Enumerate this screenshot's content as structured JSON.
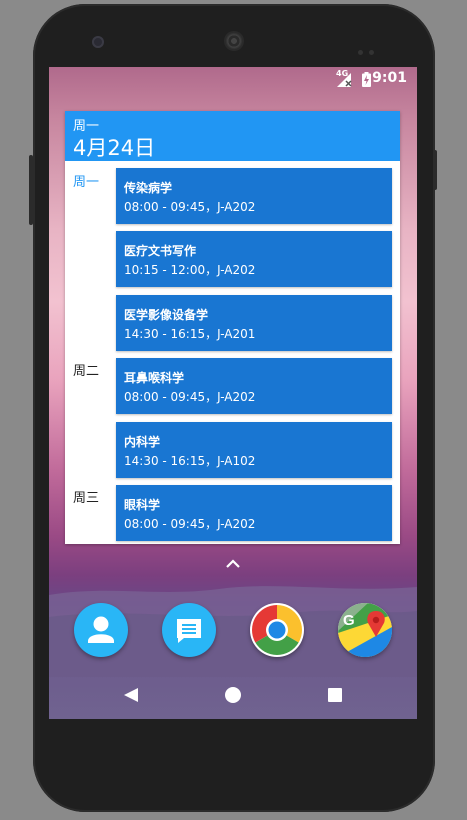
{
  "status_bar": {
    "network_type": "4G",
    "time": "9:01",
    "icons": [
      "signal-icon",
      "battery-charging-icon"
    ]
  },
  "widget": {
    "header": {
      "weekday": "周一",
      "date": "4月24日"
    },
    "days": [
      {
        "label": "周一",
        "is_today": true
      },
      {
        "label": "周二",
        "is_today": false
      },
      {
        "label": "周三",
        "is_today": false
      }
    ],
    "events": [
      {
        "title": "传染病学",
        "detail": "08:00 - 09:45，J-A202"
      },
      {
        "title": "医疗文书写作",
        "detail": "10:15 - 12:00，J-A202"
      },
      {
        "title": "医学影像设备学",
        "detail": "14:30 - 16:15，J-A201"
      },
      {
        "title": "耳鼻喉科学",
        "detail": "08:00 - 09:45，J-A202"
      },
      {
        "title": "内科学",
        "detail": "14:30 - 16:15，J-A102"
      },
      {
        "title": "眼科学",
        "detail": "08:00 - 09:45，J-A202"
      }
    ]
  },
  "launcher": {
    "app_drawer_icon": "chevron-up-icon",
    "dock": [
      "contacts-app-icon",
      "messages-app-icon",
      "chrome-app-icon",
      "maps-app-icon"
    ]
  },
  "nav_bar": {
    "buttons": [
      "back-icon",
      "home-icon",
      "recents-icon"
    ]
  },
  "colors": {
    "widget_header": "#2196f3",
    "event_card": "#1976d2",
    "today_label": "#2196f3"
  }
}
